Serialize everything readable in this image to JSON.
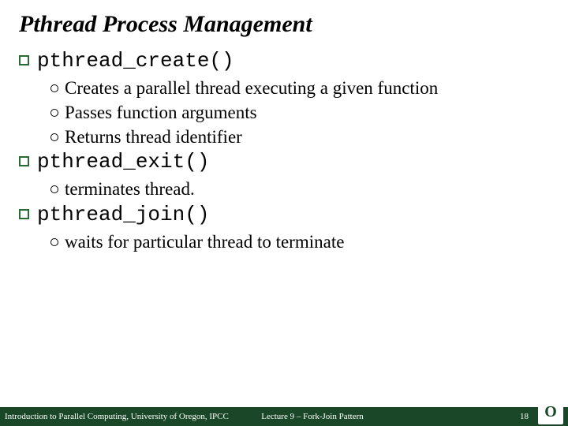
{
  "title": "Pthread Process Management",
  "items": [
    {
      "code": "pthread_create()",
      "subs": [
        "Creates a parallel thread executing a given function",
        "Passes function arguments",
        "Returns thread identifier"
      ]
    },
    {
      "code": "pthread_exit()",
      "subs": [
        "terminates thread."
      ]
    },
    {
      "code": "pthread_join()",
      "subs": [
        "waits for particular thread to terminate"
      ]
    }
  ],
  "footer": {
    "left": "Introduction to Parallel Computing, University of Oregon, IPCC",
    "center": "Lecture 9 – Fork-Join Pattern",
    "page": "18"
  },
  "logo": "O"
}
